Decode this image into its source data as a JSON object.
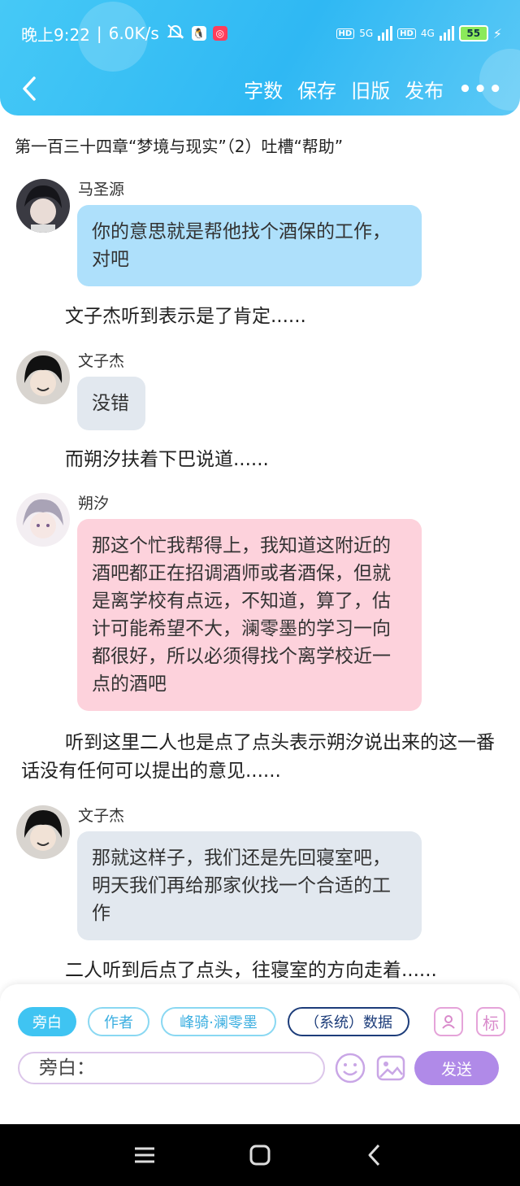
{
  "status_bar": {
    "time": "晚上9:22",
    "speed": "6.0K/s",
    "net1": "5G",
    "net2": "4G",
    "hd": "HD",
    "battery": "55"
  },
  "nav": {
    "actions": [
      "字数",
      "保存",
      "旧版",
      "发布"
    ],
    "more": "•••"
  },
  "chapter_title": "第一百三十四章“梦境与现实”（2）吐槽“帮助”",
  "messages": [
    {
      "name": "马圣源",
      "text": "你的意思就是帮他找个酒保的工作，对吧"
    },
    {
      "name": "文子杰",
      "text": "没错"
    },
    {
      "name": "朔汐",
      "text": "那这个忙我帮得上，我知道这附近的酒吧都正在招调酒师或者酒保，但就是离学校有点远，不知道，算了，估计可能希望不大，澜零墨的学习一向都很好，所以必须得找个离学校近一点的酒吧"
    },
    {
      "name": "文子杰",
      "text": "那就这样子，我们还是先回寝室吧，明天我们再给那家伙找一个合适的工作"
    }
  ],
  "narrations": [
    "文子杰听到表示是了肯定......",
    "而朔汐扶着下巴说道......",
    "听到这里二人也是点了点头表示朔汐说出来的这一番话没有任何可以提出的意见......",
    "二人听到后点了点头，往寝室的方向走着......"
  ],
  "composer": {
    "chips": [
      "旁白",
      "作者",
      "峰骑·澜零墨",
      "（系统）数据"
    ],
    "tag_label": "标",
    "input_value": "旁白：",
    "send_label": "发送"
  }
}
